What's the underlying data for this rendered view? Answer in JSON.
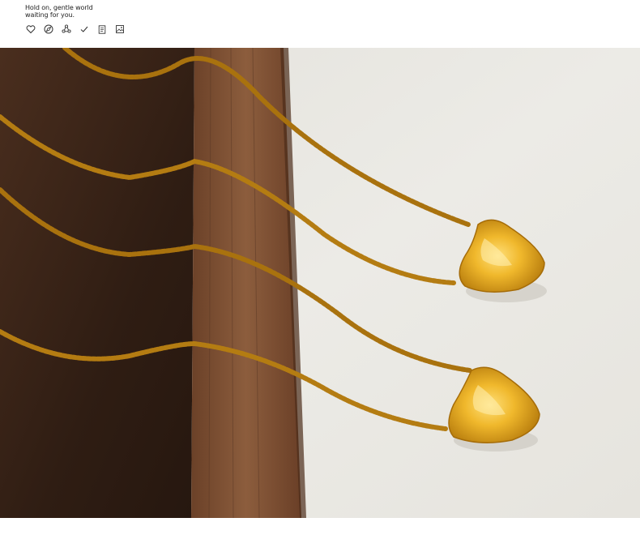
{
  "header": {
    "tagline_line1": "Hold on, gentle world",
    "tagline_line2": "waiting for you.",
    "icons": [
      "heart-icon",
      "compass-icon",
      "share-icon",
      "check-icon",
      "clipboard-icon",
      "image-icon"
    ]
  },
  "photo": {
    "subject": "gold-heart-pendant-necklaces",
    "colors": {
      "wood_dark": "#3a2418",
      "wood_light": "#8a5a3a",
      "backdrop": "#e9e7e1",
      "gold": "#d9a520"
    }
  }
}
